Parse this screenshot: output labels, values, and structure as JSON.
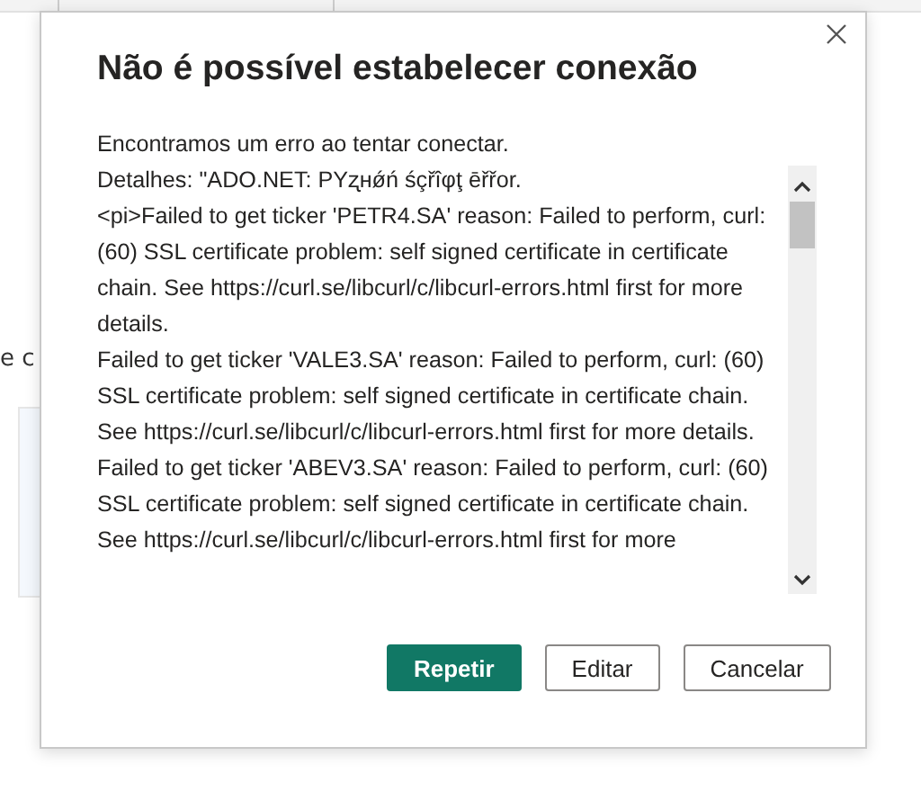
{
  "background": {
    "side_text": "e c"
  },
  "dialog": {
    "title": "Não é possível estabelecer conexão",
    "message": [
      "Encontramos um erro ao tentar conectar.",
      "Detalhes: \"ADO.NET: PΥʐнǿń śçřîφţ ēřřor.",
      "<pi>Failed to get ticker 'PETR4.SA' reason: Failed to perform, curl: (60) SSL certificate problem: self signed certificate in certificate chain. See https://curl.se/libcurl/c/libcurl-errors.html first for more details.",
      "Failed to get ticker 'VALE3.SA' reason: Failed to perform, curl: (60) SSL certificate problem: self signed certificate in certificate chain. See https://curl.se/libcurl/c/libcurl-errors.html first for more details.",
      "Failed to get ticker 'ABEV3.SA' reason: Failed to perform, curl: (60) SSL certificate problem: self signed certificate in certificate chain. See https://curl.se/libcurl/c/libcurl-errors.html first for more"
    ],
    "buttons": [
      {
        "label": "Repetir",
        "kind": "primary"
      },
      {
        "label": "Editar",
        "kind": "secondary"
      },
      {
        "label": "Cancelar",
        "kind": "secondary"
      }
    ]
  }
}
